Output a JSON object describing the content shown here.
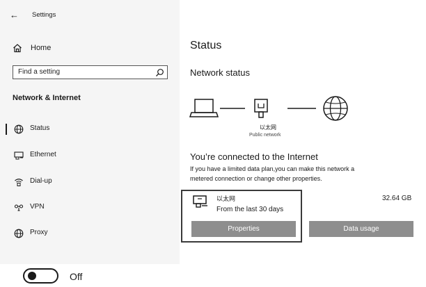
{
  "header": {
    "back_icon": "back-arrow-icon",
    "title": "Settings"
  },
  "sidebar": {
    "home_label": "Home",
    "search_placeholder": "Find a setting",
    "section_title": "Network & Internet",
    "items": [
      {
        "label": "Status",
        "icon": "globe-icon",
        "selected": true
      },
      {
        "label": "Ethernet",
        "icon": "ethernet-icon",
        "selected": false
      },
      {
        "label": "Dial-up",
        "icon": "dialup-icon",
        "selected": false
      },
      {
        "label": "VPN",
        "icon": "vpn-icon",
        "selected": false
      },
      {
        "label": "Proxy",
        "icon": "globe-icon",
        "selected": false
      }
    ]
  },
  "main": {
    "title": "Status",
    "section_title": "Network status",
    "diagram": {
      "network_name": "以太网",
      "network_type": "Public network"
    },
    "connected_text": "You’re  connected to the Internet",
    "info_line1": "If you have a limited data plan,you can make this network a",
    "info_line2": "metered connection or change other properties.",
    "card": {
      "name": "以太网",
      "period": "From the last 30 days",
      "usage": "32.64 GB"
    },
    "buttons": {
      "properties": "Properties",
      "data_usage": "Data usage"
    }
  },
  "toggle": {
    "state_label": "Off",
    "on": false
  }
}
